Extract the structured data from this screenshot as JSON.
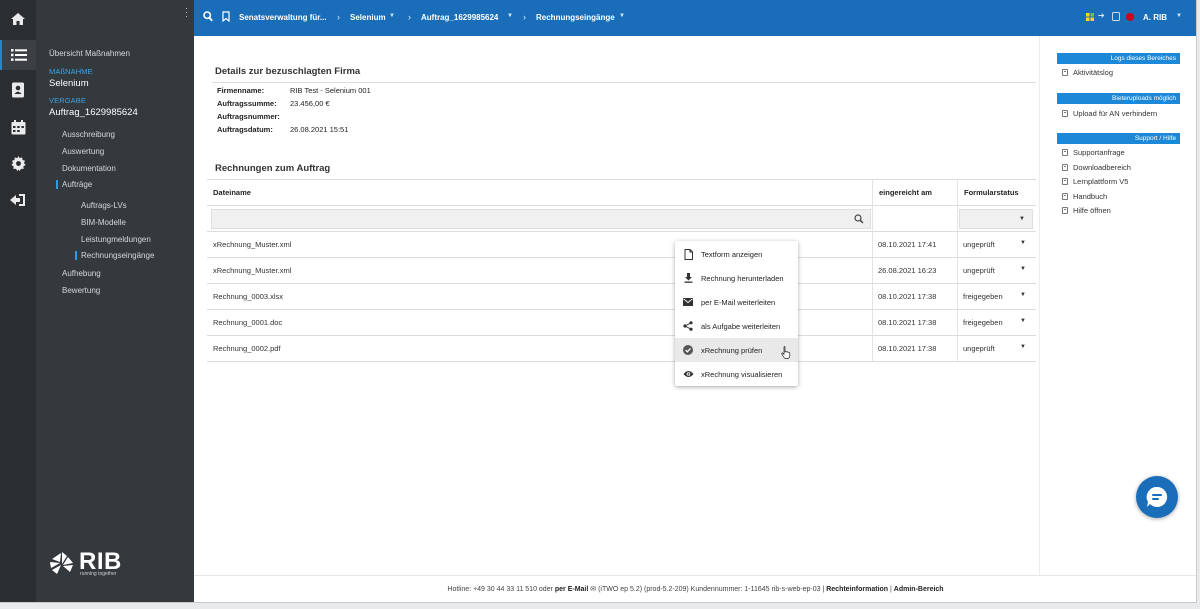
{
  "sidebar": {
    "overview": "Übersicht Maßnahmen",
    "massnahme_caption": "MAßNAHME",
    "massnahme_value": "Selenium",
    "vergabe_caption": "VERGABE",
    "vergabe_value": "Auftrag_1629985624",
    "items": [
      "Ausschreibung",
      "Auswertung",
      "Dokumentation",
      "Aufträge"
    ],
    "subitems": [
      "Auftrags-LVs",
      "BIM-Modelle",
      "Leistungmeldungen",
      "Rechnungseingänge"
    ],
    "items2": [
      "Aufhebung",
      "Bewertung"
    ],
    "logo_text": "RIB",
    "logo_tagline": "running together"
  },
  "topbar": {
    "crumbs": [
      "Senatsverwaltung für...",
      "Selenium",
      "Auftrag_1629985624",
      "Rechnungseingänge"
    ],
    "user": "A. RIB"
  },
  "details": {
    "title": "Details zur bezuschlagten Firma",
    "fields": [
      {
        "label": "Firmenname:",
        "value": "RIB Test - Selenium 001"
      },
      {
        "label": "Auftragssumme:",
        "value": "23.456,00 €"
      },
      {
        "label": "Auftragsnummer:",
        "value": ""
      },
      {
        "label": "Auftragsdatum:",
        "value": "26.08.2021 15:51"
      }
    ]
  },
  "invoices": {
    "title": "Rechnungen zum Auftrag",
    "columns": [
      "Dateiname",
      "eingereicht am",
      "Formularstatus"
    ],
    "rows": [
      {
        "file": "xRechnung_Muster.xml",
        "date": "08.10.2021 17:41",
        "status": "ungeprüft"
      },
      {
        "file": "xRechnung_Muster.xml",
        "date": "26.08.2021 16:23",
        "status": "ungeprüft"
      },
      {
        "file": "Rechnung_0003.xlsx",
        "date": "08.10.2021 17:38",
        "status": "freigegeben"
      },
      {
        "file": "Rechnung_0001.doc",
        "date": "08.10.2021 17:38",
        "status": "freigegeben"
      },
      {
        "file": "Rechnung_0002.pdf",
        "date": "08.10.2021 17:38",
        "status": "ungeprüft"
      }
    ]
  },
  "context_menu": {
    "items": [
      {
        "label": "Textform anzeigen",
        "icon": "document-icon"
      },
      {
        "label": "Rechnung herunterladen",
        "icon": "download-icon"
      },
      {
        "label": "per E-Mail weiterleiten",
        "icon": "mail-icon"
      },
      {
        "label": "als Aufgabe weiterleiten",
        "icon": "share-icon"
      },
      {
        "label": "xRechnung prüfen",
        "icon": "check-circle-icon"
      },
      {
        "label": "xRechnung visualisieren",
        "icon": "eye-icon"
      }
    ],
    "hovered_index": 4
  },
  "right_panel": {
    "sections": [
      {
        "title": "Logs dieses Bereiches",
        "links": [
          "Aktivitätslog"
        ]
      },
      {
        "title": "Bieteruploads möglich",
        "links": [
          "Upload für AN verhindern"
        ]
      },
      {
        "title": "Support / Hilfe",
        "links": [
          "Supportanfrage",
          "Downloadbereich",
          "Lernplattform V5",
          "Handbuch",
          "Hilfe öffnen"
        ]
      }
    ]
  },
  "footer": {
    "pre": "Hotline: +49 30 44 33 11 510 oder ",
    "email": "per E-Mail",
    "mid": " (iTWO ep 5.2) (prod-5.2-209)  Kundennummer: 1-11645 rib-s-web-ep-03 | ",
    "legal": "Rechteinformation",
    "sep": " | ",
    "admin": "Admin-Bereich"
  },
  "colors": {
    "accent": "#1a6eb9",
    "sidebar": "#34393d",
    "iconbar": "#2b2e31",
    "highlight": "#1e88d8"
  }
}
